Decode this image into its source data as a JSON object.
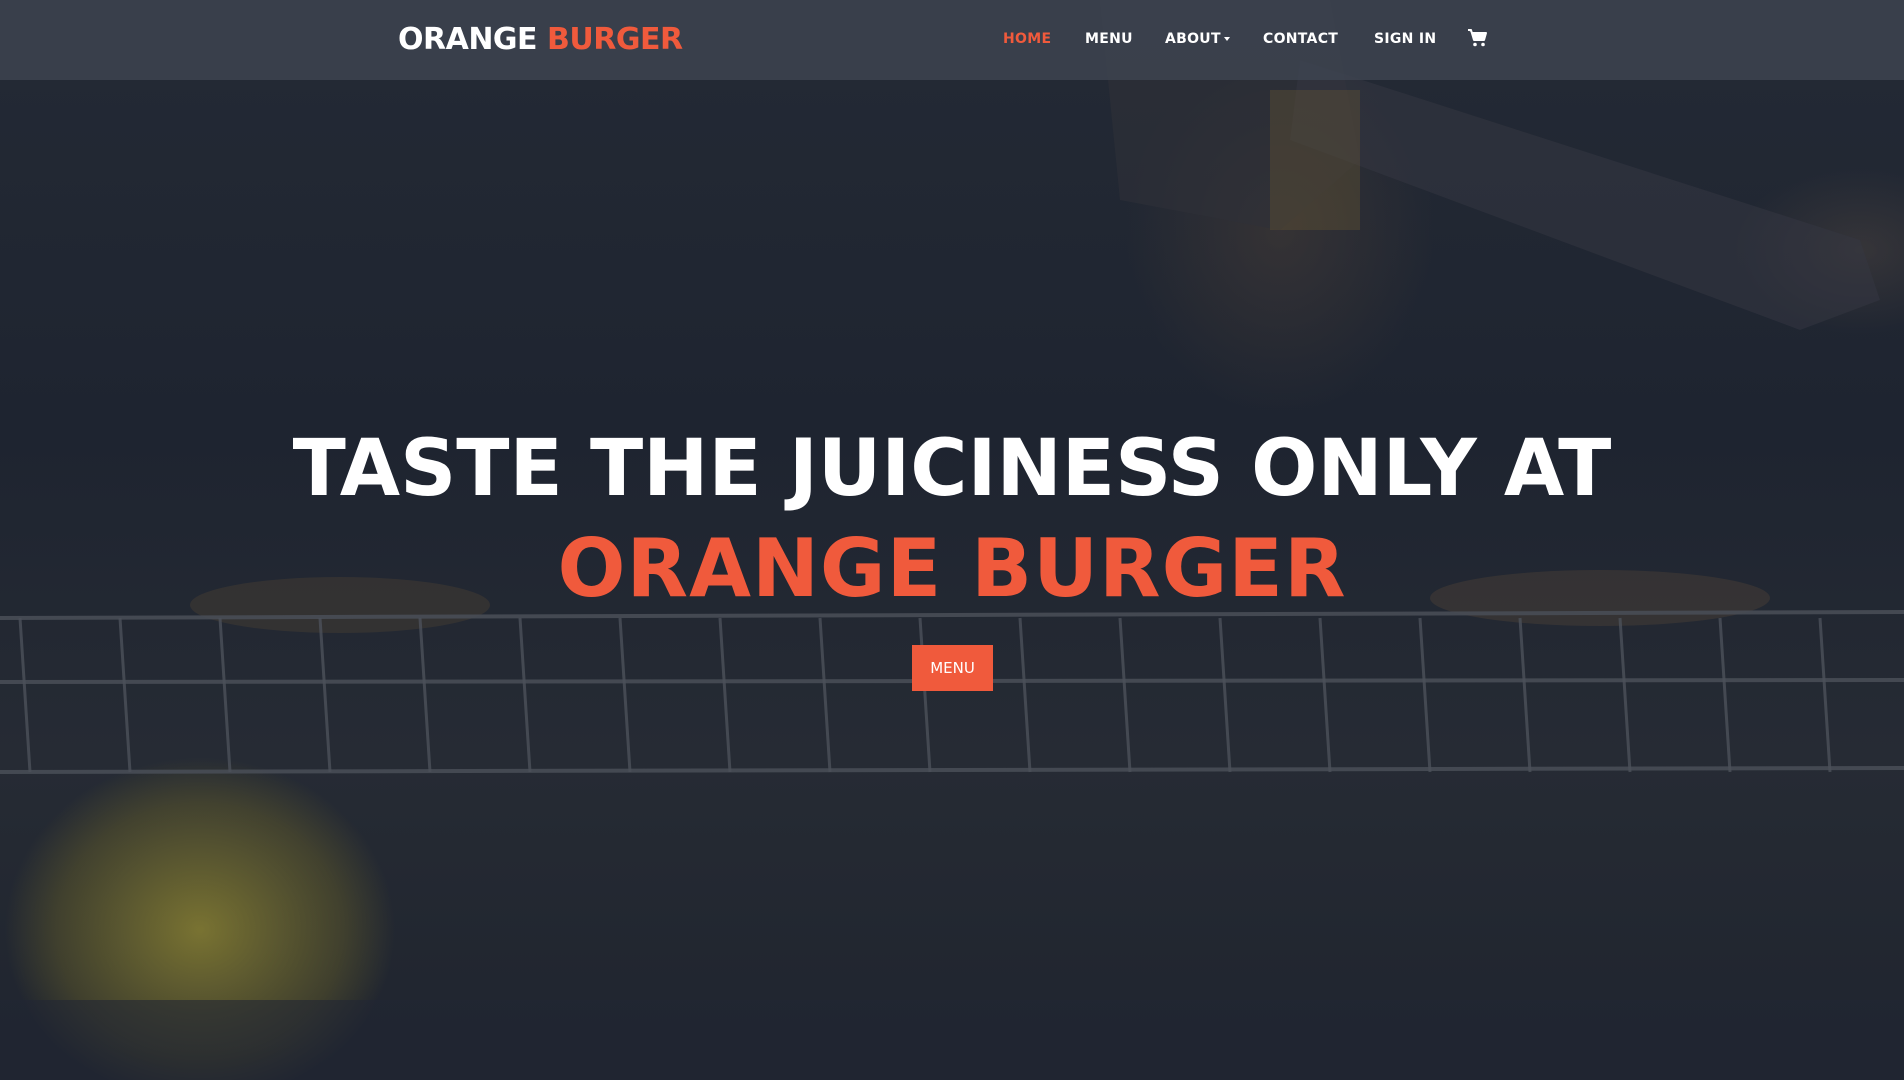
{
  "brand": {
    "part1": "ORANGE",
    "part2": "BURGER"
  },
  "nav": {
    "home": "HOME",
    "menu": "MENU",
    "about": "ABOUT",
    "contact": "CONTACT",
    "sign_in": "SIGN IN",
    "cart_icon": "shopping-cart-icon"
  },
  "hero": {
    "line1": "TASTE THE JUICINESS ONLY AT",
    "line2": "ORANGE BURGER",
    "cta_label": "MENU"
  },
  "colors": {
    "accent": "#f05a3c",
    "navbar_bg": "#3e4450",
    "hero_overlay": "#1f2530",
    "text": "#ffffff"
  }
}
